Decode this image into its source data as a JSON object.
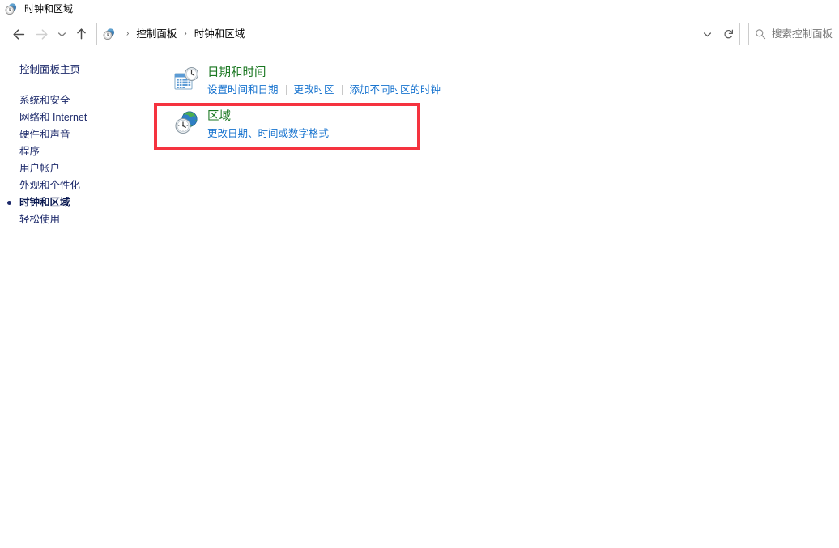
{
  "window": {
    "title": "时钟和区域",
    "title_icon": "clock-globe-icon"
  },
  "navigation": {
    "back_label": "后退",
    "forward_label": "前进",
    "recent_label": "最近的位置",
    "up_label": "上移一级",
    "address_icon": "clock-globe-icon",
    "breadcrumbs": [
      {
        "label": "控制面板"
      },
      {
        "label": "时钟和区域"
      }
    ],
    "separator": "›",
    "dropdown_label": "历史记录",
    "refresh_label": "刷新"
  },
  "search": {
    "placeholder": "搜索控制面板",
    "value": "",
    "icon": "search-icon"
  },
  "sidebar": {
    "home": {
      "label": "控制面板主页"
    },
    "items": [
      {
        "label": "系统和安全",
        "current": false
      },
      {
        "label": "网络和 Internet",
        "current": false
      },
      {
        "label": "硬件和声音",
        "current": false
      },
      {
        "label": "程序",
        "current": false
      },
      {
        "label": "用户帐户",
        "current": false
      },
      {
        "label": "外观和个性化",
        "current": false
      },
      {
        "label": "时钟和区域",
        "current": true
      },
      {
        "label": "轻松使用",
        "current": false
      }
    ]
  },
  "categories": [
    {
      "icon": "calendar-clock-icon",
      "title": "日期和时间",
      "links": [
        "设置时间和日期",
        "更改时区",
        "添加不同时区的时钟"
      ]
    },
    {
      "icon": "globe-clock-icon",
      "title": "区域",
      "links": [
        "更改日期、时间或数字格式"
      ]
    }
  ],
  "annotation": {
    "type": "highlight-rectangle",
    "color": "#f5333f",
    "target": "区域"
  },
  "colors": {
    "category_title": "#18761f",
    "category_link": "#1773cf",
    "sidebar_link": "#1d2a6b",
    "highlight": "#f5333f",
    "placeholder": "#767676"
  }
}
